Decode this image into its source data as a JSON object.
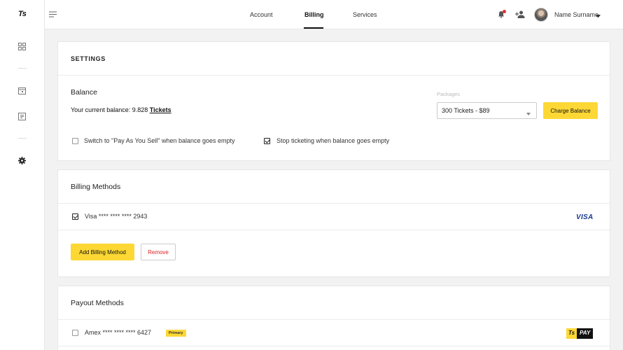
{
  "app": {
    "logo_text": "Ts"
  },
  "sidebar": {
    "icons": [
      "dashboard-icon",
      "calendar-icon",
      "document-icon",
      "gear-icon"
    ]
  },
  "header": {
    "tabs": [
      {
        "label": "Account",
        "active": false
      },
      {
        "label": "Billing",
        "active": true
      },
      {
        "label": "Services",
        "active": false
      }
    ],
    "user_name": "Name Surname",
    "notification_dot_color": "#e53030"
  },
  "settings": {
    "title": "SETTINGS",
    "balance": {
      "heading": "Balance",
      "text_prefix": "Your current balance: 9.828 ",
      "tickets_link": "Tickets"
    },
    "packages": {
      "label": "Packages",
      "selected": "300 Tickets - $89"
    },
    "charge_button": "Charge Balance",
    "options": [
      {
        "label": "Switch to \"Pay As You Sell\" when balance goes empty",
        "checked": false
      },
      {
        "label": "Stop ticketing when balance goes empty",
        "checked": true
      }
    ]
  },
  "billing": {
    "title": "Billing Methods",
    "methods": [
      {
        "label": "Visa **** **** **** 2943",
        "checked": true,
        "brand": "VISA"
      }
    ],
    "add_button": "Add Billing Method",
    "remove_button": "Remove"
  },
  "payout": {
    "title": "Payout Methods",
    "methods": [
      {
        "label": "Amex **** **** **** 6427",
        "checked": false,
        "badge": "Primary",
        "brand_ts": "Ts",
        "brand_pay": "PAY"
      }
    ]
  },
  "colors": {
    "accent": "#fdd835",
    "danger": "#dd2222",
    "visa": "#1a3a8f"
  }
}
